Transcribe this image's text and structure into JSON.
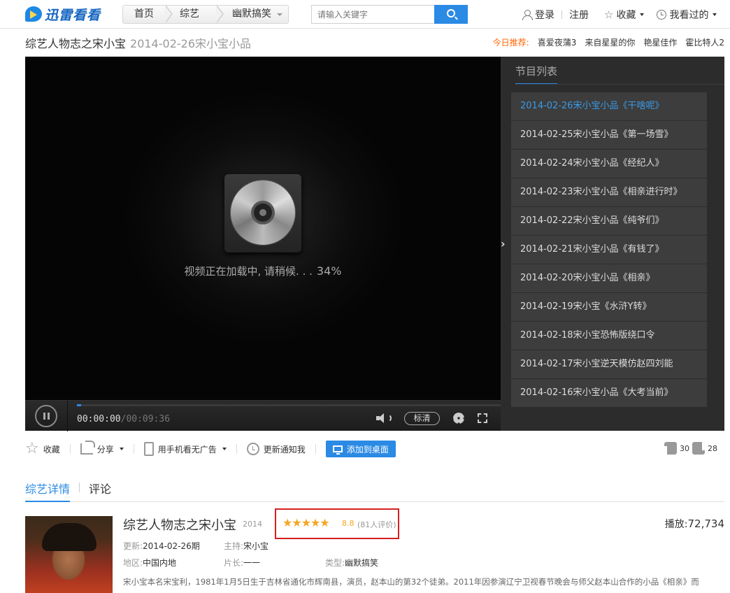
{
  "header": {
    "logo_text": "迅雷看看",
    "breadcrumbs": [
      "首页",
      "综艺",
      "幽默搞笑"
    ],
    "search_placeholder": "请输入关键字",
    "login": "登录",
    "register": "注册",
    "favorites": "收藏",
    "history": "我看过的"
  },
  "titlebar": {
    "title": "综艺人物志之宋小宝",
    "subtitle": "2014-02-26宋小宝小品",
    "recommend_label": "今日推荐:",
    "recommend_items": [
      "喜爱夜蒲3",
      "来自星星的你",
      "艳星佳作",
      "霍比特人2"
    ]
  },
  "player": {
    "loading_text": "视频正在加载中, 请稍候. . .",
    "loading_percent": "34%",
    "progress": 0.01,
    "current_time": "00:00:00",
    "total_time": "/00:09:36",
    "quality": "标清"
  },
  "sidebar": {
    "title": "节目列表",
    "items": [
      "2014-02-26宋小宝小品《干啥呢》",
      "2014-02-25宋小宝小品《第一场雪》",
      "2014-02-24宋小宝小品《经纪人》",
      "2014-02-23宋小宝小品《相亲进行时》",
      "2014-02-22宋小宝小品《纯爷们》",
      "2014-02-21宋小宝小品《有钱了》",
      "2014-02-20宋小宝小品《相亲》",
      "2014-02-19宋小宝《水浒Y转》",
      "2014-02-18宋小宝恐怖版绕口令",
      "2014-02-17宋小宝逆天模仿赵四刘能",
      "2014-02-16宋小宝小品《大考当前》"
    ]
  },
  "actions": {
    "favorite": "收藏",
    "share": "分享",
    "mobile": "用手机看无广告",
    "notify": "更新通知我",
    "desktop": "添加到桌面",
    "likes": "30",
    "dislikes": "28"
  },
  "tabs": [
    "综艺详情",
    "评论"
  ],
  "details": {
    "title": "综艺人物志之宋小宝",
    "year": "2014",
    "stars": "★★★★★",
    "rating": 8.8,
    "rating_score": "8.8",
    "rating_count": "(81人评价)",
    "plays_label": "播放:",
    "plays": "72,734",
    "update_label": "更新:",
    "update_value": "2014-02-26期",
    "host_label": "主持:",
    "host_value": "宋小宝",
    "region_label": "地区:",
    "region_value": "中国内地",
    "length_label": "片长:",
    "length_value": "一一",
    "genre_label": "类型:",
    "genre_value": "幽默搞笑",
    "description": "宋小宝本名宋宝利，1981年1月5日生于吉林省通化市辉南县，演员，赵本山的第32个徒弟。2011年因参演辽宁卫视春节晚会与师父赵本山合作的小品《相亲》而"
  },
  "colors": {
    "accent": "#2a8ae4",
    "active_episode": "#3a9be8",
    "recommend_label": "#ff6600",
    "rating": "#f5a623",
    "highlight_border": "#d42020"
  }
}
